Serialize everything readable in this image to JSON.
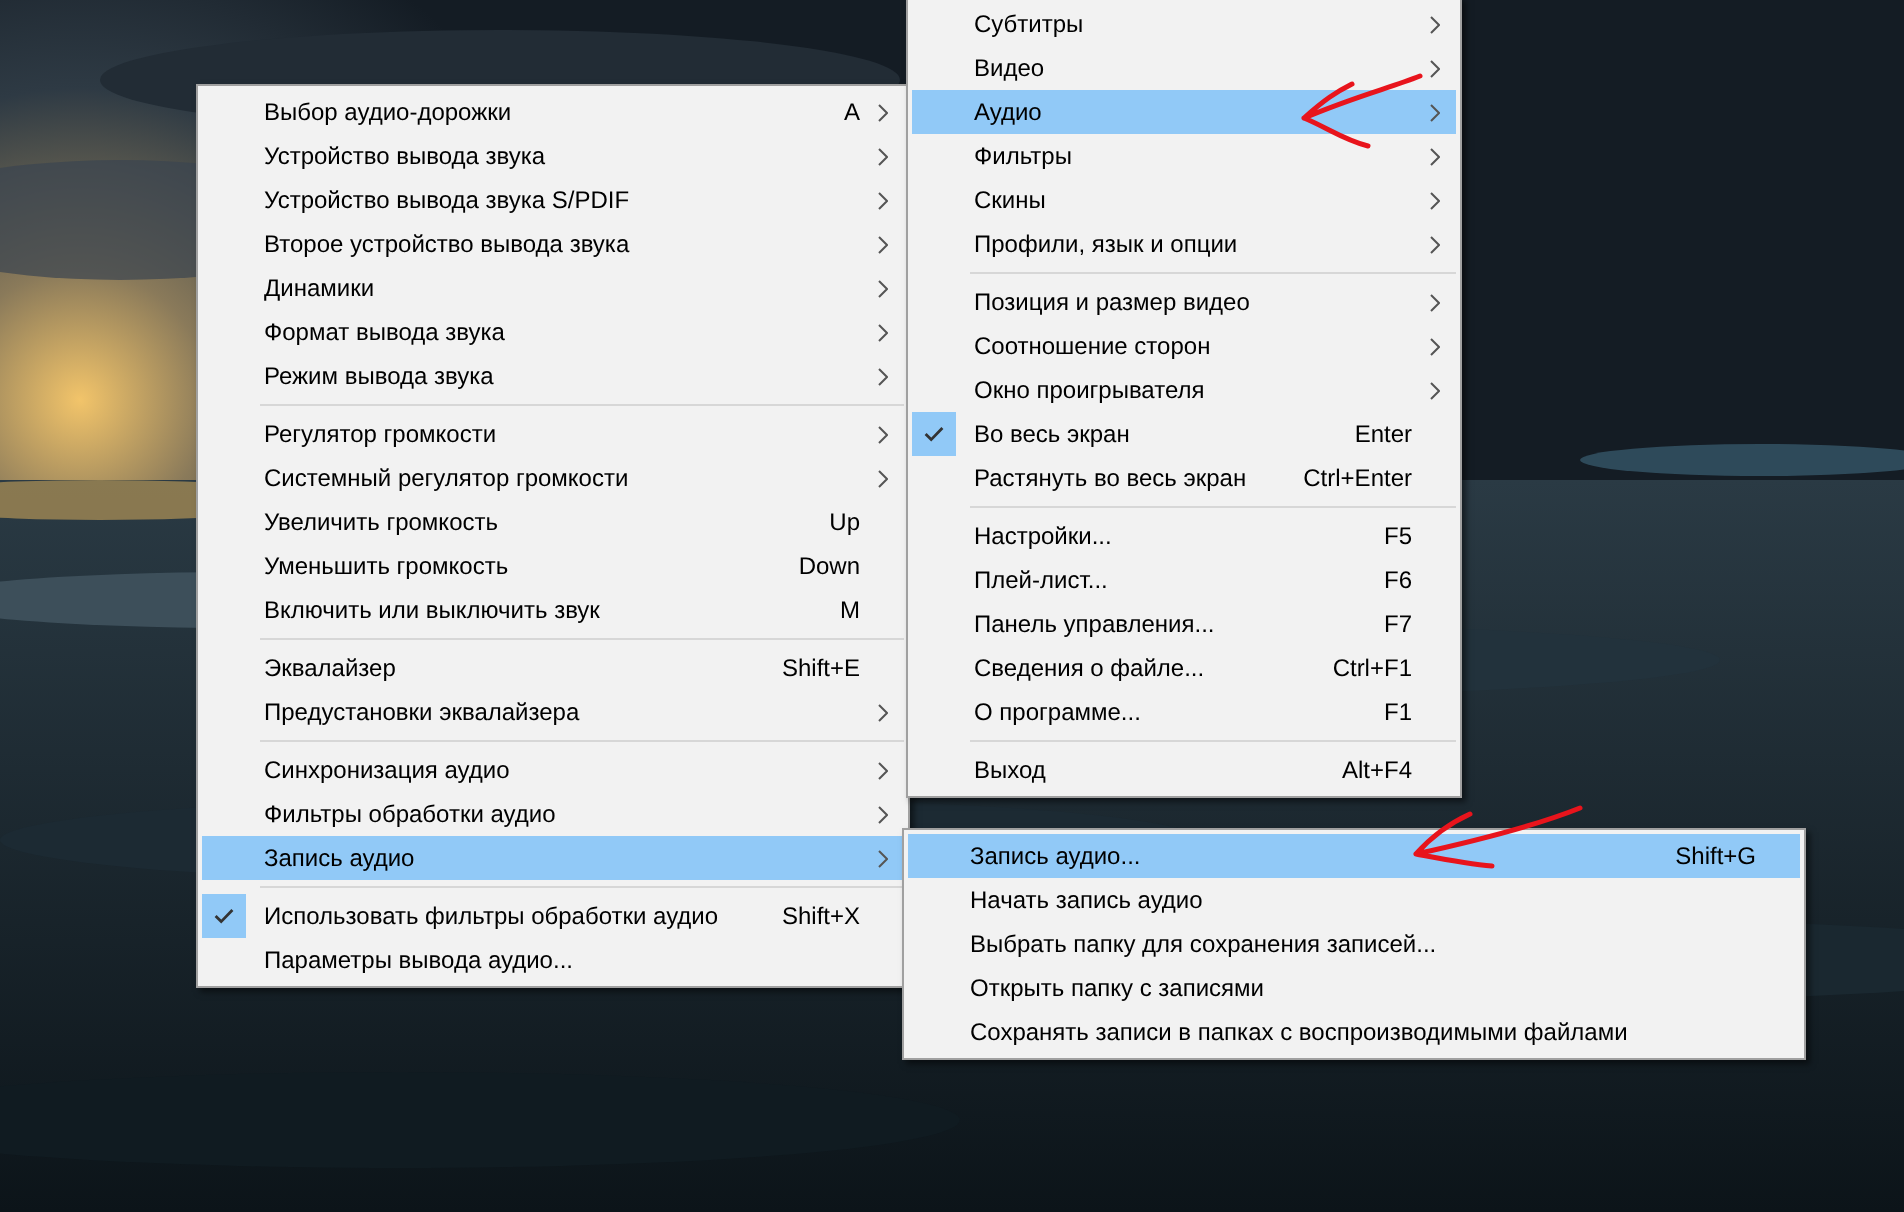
{
  "menus": [
    {
      "items": [
        {
          "kind": "item",
          "label": "Субтитры",
          "submenu": true,
          "checked": false,
          "selected": false
        },
        {
          "kind": "item",
          "label": "Видео",
          "submenu": true,
          "checked": false,
          "selected": false
        },
        {
          "kind": "item",
          "label": "Аудио",
          "submenu": true,
          "checked": false,
          "selected": true
        },
        {
          "kind": "item",
          "label": "Фильтры",
          "submenu": true,
          "checked": false,
          "selected": false
        },
        {
          "kind": "item",
          "label": "Скины",
          "submenu": true,
          "checked": false,
          "selected": false
        },
        {
          "kind": "item",
          "label": "Профили, язык и опции",
          "submenu": true,
          "checked": false,
          "selected": false
        },
        {
          "kind": "separator"
        },
        {
          "kind": "item",
          "label": "Позиция и размер видео",
          "submenu": true,
          "checked": false,
          "selected": false
        },
        {
          "kind": "item",
          "label": "Соотношение сторон",
          "submenu": true,
          "checked": false,
          "selected": false
        },
        {
          "kind": "item",
          "label": "Окно проигрывателя",
          "submenu": true,
          "checked": false,
          "selected": false
        },
        {
          "kind": "item",
          "label": "Во весь экран",
          "shortcut": "Enter",
          "submenu": false,
          "checked": true,
          "selected": false
        },
        {
          "kind": "item",
          "label": "Растянуть во весь экран",
          "shortcut": "Ctrl+Enter",
          "submenu": false,
          "checked": false,
          "selected": false
        },
        {
          "kind": "separator"
        },
        {
          "kind": "item",
          "label": "Настройки...",
          "shortcut": "F5",
          "submenu": false,
          "checked": false,
          "selected": false
        },
        {
          "kind": "item",
          "label": "Плей-лист...",
          "shortcut": "F6",
          "submenu": false,
          "checked": false,
          "selected": false
        },
        {
          "kind": "item",
          "label": "Панель управления...",
          "shortcut": "F7",
          "submenu": false,
          "checked": false,
          "selected": false
        },
        {
          "kind": "item",
          "label": "Сведения о файле...",
          "shortcut": "Ctrl+F1",
          "submenu": false,
          "checked": false,
          "selected": false
        },
        {
          "kind": "item",
          "label": "О программе...",
          "shortcut": "F1",
          "submenu": false,
          "checked": false,
          "selected": false
        },
        {
          "kind": "separator"
        },
        {
          "kind": "item",
          "label": "Выход",
          "shortcut": "Alt+F4",
          "submenu": false,
          "checked": false,
          "selected": false
        }
      ]
    },
    {
      "items": [
        {
          "kind": "item",
          "label": "Выбор аудио-дорожки",
          "shortcut": "A",
          "submenu": true,
          "checked": false,
          "selected": false
        },
        {
          "kind": "item",
          "label": "Устройство вывода звука",
          "submenu": true,
          "checked": false,
          "selected": false
        },
        {
          "kind": "item",
          "label": "Устройство вывода звука S/PDIF",
          "submenu": true,
          "checked": false,
          "selected": false
        },
        {
          "kind": "item",
          "label": "Второе устройство вывода звука",
          "submenu": true,
          "checked": false,
          "selected": false
        },
        {
          "kind": "item",
          "label": "Динамики",
          "submenu": true,
          "checked": false,
          "selected": false
        },
        {
          "kind": "item",
          "label": "Формат вывода звука",
          "submenu": true,
          "checked": false,
          "selected": false
        },
        {
          "kind": "item",
          "label": "Режим вывода звука",
          "submenu": true,
          "checked": false,
          "selected": false
        },
        {
          "kind": "separator"
        },
        {
          "kind": "item",
          "label": "Регулятор громкости",
          "submenu": true,
          "checked": false,
          "selected": false
        },
        {
          "kind": "item",
          "label": "Системный регулятор громкости",
          "submenu": true,
          "checked": false,
          "selected": false
        },
        {
          "kind": "item",
          "label": "Увеличить громкость",
          "shortcut": "Up",
          "submenu": false,
          "checked": false,
          "selected": false
        },
        {
          "kind": "item",
          "label": "Уменьшить громкость",
          "shortcut": "Down",
          "submenu": false,
          "checked": false,
          "selected": false
        },
        {
          "kind": "item",
          "label": "Включить или выключить звук",
          "shortcut": "M",
          "submenu": false,
          "checked": false,
          "selected": false
        },
        {
          "kind": "separator"
        },
        {
          "kind": "item",
          "label": "Эквалайзер",
          "shortcut": "Shift+E",
          "submenu": false,
          "checked": false,
          "selected": false
        },
        {
          "kind": "item",
          "label": "Предустановки эквалайзера",
          "submenu": true,
          "checked": false,
          "selected": false
        },
        {
          "kind": "separator"
        },
        {
          "kind": "item",
          "label": "Синхронизация аудио",
          "submenu": true,
          "checked": false,
          "selected": false
        },
        {
          "kind": "item",
          "label": "Фильтры обработки аудио",
          "submenu": true,
          "checked": false,
          "selected": false
        },
        {
          "kind": "item",
          "label": "Запись аудио",
          "submenu": true,
          "checked": false,
          "selected": true
        },
        {
          "kind": "separator"
        },
        {
          "kind": "item",
          "label": "Использовать фильтры обработки аудио",
          "shortcut": "Shift+X",
          "submenu": false,
          "checked": true,
          "selected": false
        },
        {
          "kind": "item",
          "label": "Параметры вывода аудио...",
          "submenu": false,
          "checked": false,
          "selected": false
        }
      ]
    },
    {
      "items": [
        {
          "kind": "item",
          "label": "Запись аудио...",
          "shortcut": "Shift+G",
          "submenu": false,
          "checked": false,
          "selected": true
        },
        {
          "kind": "item",
          "label": "Начать запись аудио",
          "submenu": false,
          "checked": false,
          "selected": false
        },
        {
          "kind": "item",
          "label": "Выбрать папку для сохранения записей...",
          "submenu": false,
          "checked": false,
          "selected": false
        },
        {
          "kind": "item",
          "label": "Открыть папку с записями",
          "submenu": false,
          "checked": false,
          "selected": false
        },
        {
          "kind": "item",
          "label": "Сохранять записи в папках с воспроизводимыми файлами",
          "submenu": false,
          "checked": false,
          "selected": false
        }
      ]
    }
  ]
}
